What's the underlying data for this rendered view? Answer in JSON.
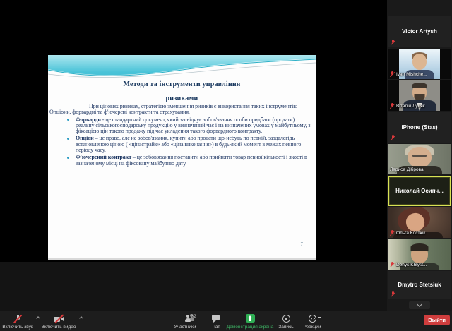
{
  "slide": {
    "title_line1": "Методи та інструменти управління",
    "title_line2": "ризиками",
    "intro": "При цінових ризиках, стратегією зменшення ризиків є використання таких інструментів: Опціони, форвардні та ф'ючерсні контракти та страхування.",
    "bullets": [
      {
        "term": "Форварди",
        "sep": " - ",
        "text": "це стандартний документ, який засвідчує зобов'язання особи придбати (продати) реальну сільськогосподарську продукцію у визначений час і на визначених умовах у майбутньому, з фіксацією цін такого продажу під час укладення такого форвардного контракту."
      },
      {
        "term": "Опціон",
        "sep": " – ",
        "text": "це право, але не зобов'язання, купити або продати що-небудь по певній, заздалегідь встановленою ціною ( «цінастрайк» або «ціна виконання») в будь-який момент в межах певного періоду часу."
      },
      {
        "term": "Ф'ючерсний контракт",
        "sep": " – ",
        "text": "це зобов'язання поставити або прийняти товар певної кількості і якості в зазначеному місці на фіксовану майбутню дату."
      }
    ],
    "page_number": "7"
  },
  "participants": [
    {
      "name": "Victor Artysh",
      "video": false,
      "muted": true
    },
    {
      "name": "Ivan Mishche...",
      "video": true,
      "muted": true
    },
    {
      "name": "Віталій Луцяк",
      "video": true,
      "muted": true
    },
    {
      "name": "iPhone (Stas)",
      "video": false,
      "muted": true
    },
    {
      "name": "Лариса Діброва",
      "video": true,
      "muted": false
    },
    {
      "name": "Николай  Осипч...",
      "video": false,
      "muted": false,
      "active_speaker": true
    },
    {
      "name": "Ольга Костюк",
      "video": true,
      "muted": true
    },
    {
      "name": "Denys Khlyst...",
      "video": true,
      "muted": true
    },
    {
      "name": "Dmytro Stetsiuk",
      "video": false,
      "muted": true
    }
  ],
  "toolbar": {
    "unmute_label": "Включить звук",
    "start_video_label": "Включить видео",
    "participants_label": "Участники",
    "participants_count": "32",
    "chat_label": "Чат",
    "share_label": "Демонстрация экрана",
    "record_label": "Запись",
    "reactions_label": "Реакции",
    "leave_label": "Выйти"
  },
  "colors": {
    "share_green": "#2fae54",
    "leave_red": "#cf3d3d",
    "muted_mic_red": "#d8393b",
    "active_speaker_border": "#d8e254",
    "slide_wave_teal": "#49c3d8",
    "slide_text_navy": "#1f3864"
  }
}
